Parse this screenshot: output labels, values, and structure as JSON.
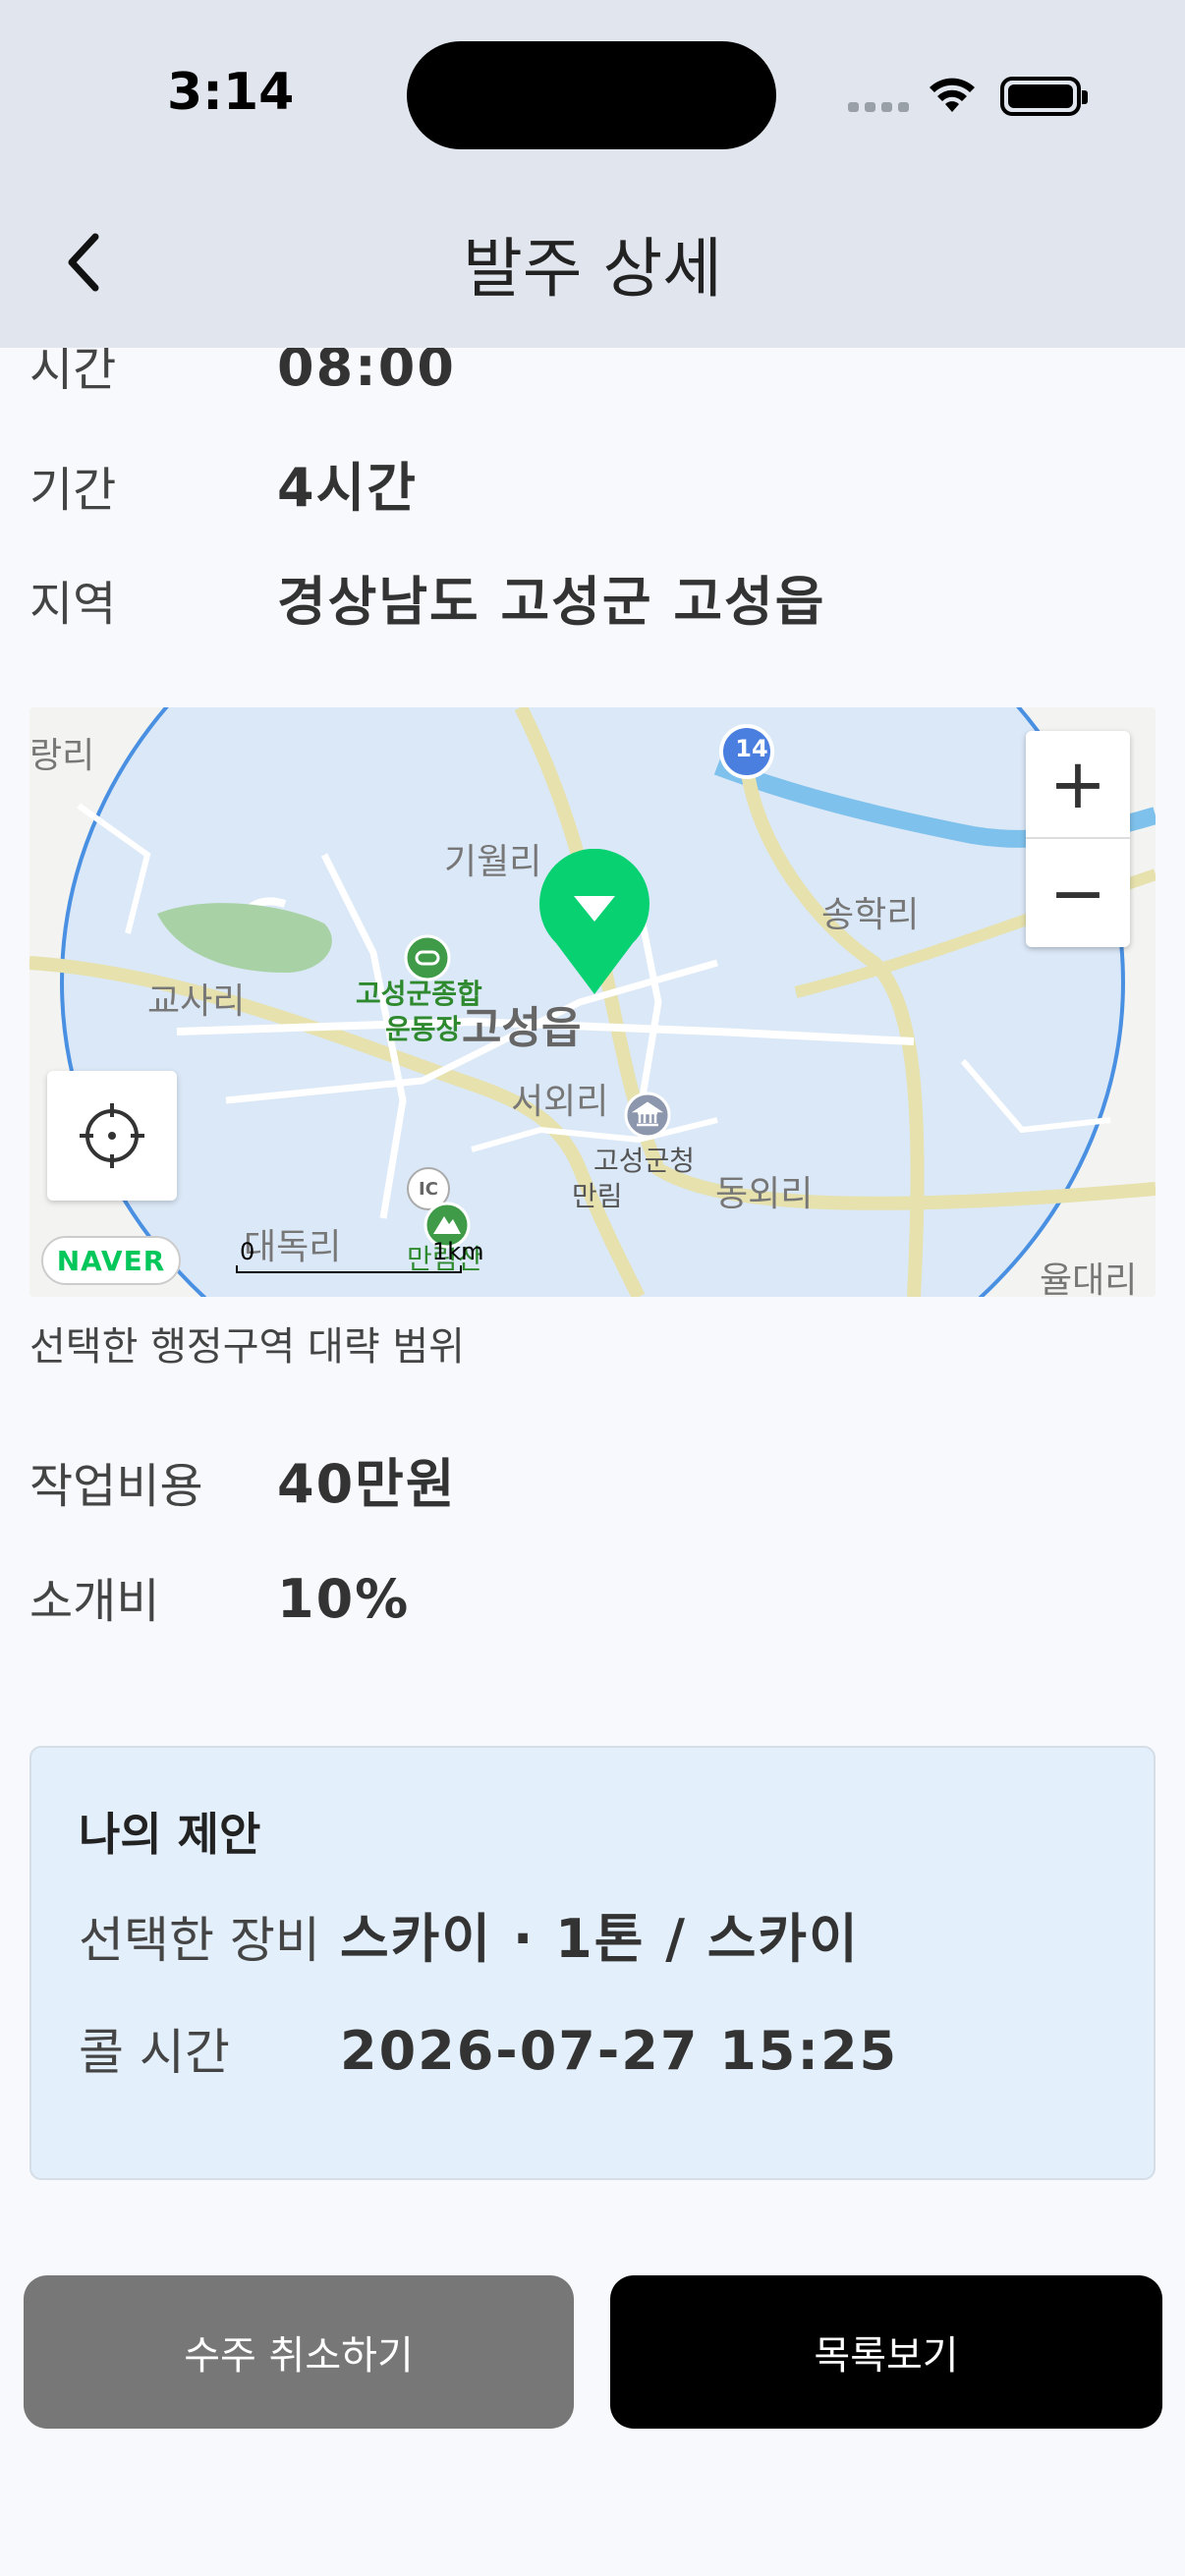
{
  "status_bar": {
    "time": "3:14"
  },
  "header": {
    "title": "발주 상세",
    "back_icon": "chevron-left-icon"
  },
  "details": {
    "time": {
      "label": "시간",
      "value": "08:00"
    },
    "duration": {
      "label": "기간",
      "value": "4시간"
    },
    "region": {
      "label": "지역",
      "value": "경상남도 고성군 고성읍"
    }
  },
  "map": {
    "labels": {
      "giwol": "기월리",
      "songhak": "송학리",
      "gosa": "교사리",
      "complex": "고성군종합",
      "complex2": "운동장",
      "town": "고성읍",
      "seooe": "서외리",
      "county_office": "고성군청",
      "dongoe": "동외리",
      "daedok": "대독리",
      "manrim": "만림",
      "yuldae": "율대리",
      "wolryang": "랑리",
      "mountain": "만림산",
      "road_14": "14",
      "ic": "IC"
    },
    "scale": {
      "zero": "0",
      "unit": "1km"
    },
    "naver_logo": "NAVER",
    "zoom_in": "+",
    "zoom_out": "−",
    "caption": "선택한 행정구역 대략 범위",
    "colors": {
      "range_fill": "#d9e8f8",
      "range_stroke": "#4a90e2",
      "marker": "#08d172",
      "river": "#7ec1ec"
    }
  },
  "fees": {
    "work_cost": {
      "label": "작업비용",
      "value": "40만원"
    },
    "referral": {
      "label": "소개비",
      "value": "10%"
    }
  },
  "proposal": {
    "title": "나의 제안",
    "equipment": {
      "label": "선택한 장비",
      "value": "스카이 · 1톤 / 스카이"
    },
    "call_time": {
      "label": "콜 시간",
      "value": "2026-07-27 15:25"
    }
  },
  "buttons": {
    "cancel": "수주 취소하기",
    "list": "목록보기"
  }
}
